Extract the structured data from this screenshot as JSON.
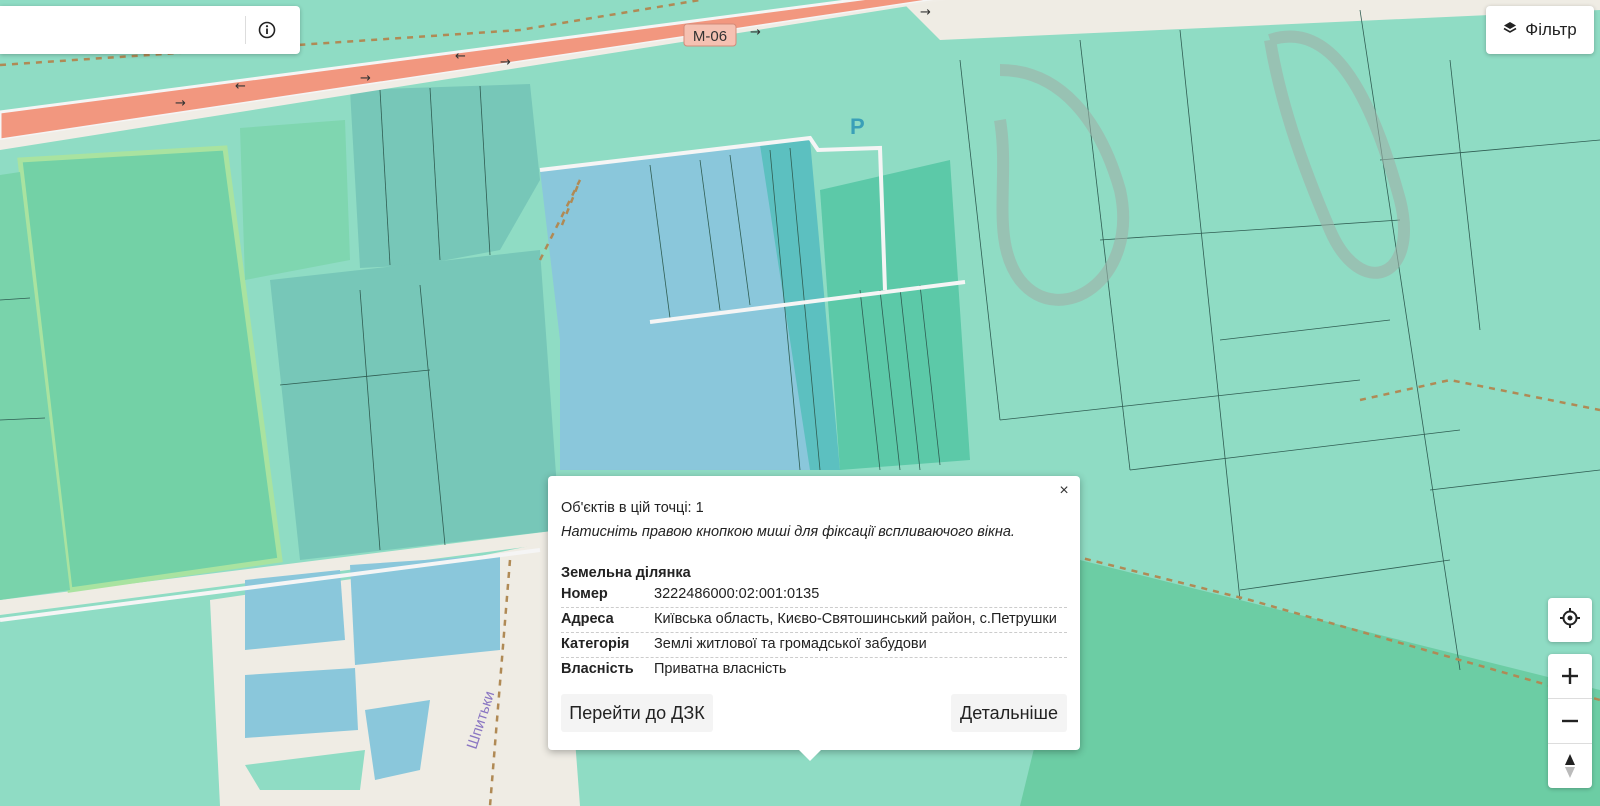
{
  "map": {
    "road_label": "М-06",
    "street_label": "Шпитьки",
    "parking_label": "P"
  },
  "search": {
    "value": "",
    "info_icon": "info-icon"
  },
  "filter": {
    "label": "Фільтр",
    "icon": "layers-icon"
  },
  "controls": {
    "locate_icon": "crosshair-icon",
    "zoom_in": "+",
    "zoom_out": "−",
    "compass_icon": "compass-icon"
  },
  "popup": {
    "close": "×",
    "count_text": "Об'єктів в цій точці: 1",
    "hint": "Натисніть правою кнопкою миші для фіксації вспливаючого вікна.",
    "section_title": "Земельна ділянка",
    "rows": [
      {
        "key": "Номер",
        "value": "3222486000:02:001:0135"
      },
      {
        "key": "Адреса",
        "value": "Київська область, Києво-Святошинський район, с.Петрушки"
      },
      {
        "key": "Категорія",
        "value": "Землі житлової та громадської забудови"
      },
      {
        "key": "Власність",
        "value": "Приватна власність"
      }
    ],
    "btn_dzk": "Перейти до ДЗК",
    "btn_more": "Детальніше"
  }
}
